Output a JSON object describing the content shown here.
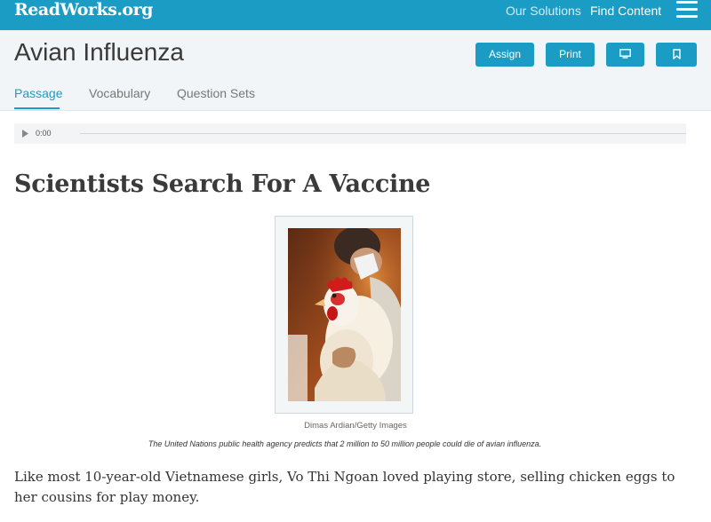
{
  "topbar": {
    "logo_main": "ReadWorks",
    "logo_tld": ".org",
    "nav_solutions": "Our Solutions",
    "nav_find": "Find Content",
    "menu_icon": "hamburger-menu-icon",
    "color": "#1a9cc4"
  },
  "header": {
    "title": "Avian Influenza",
    "buttons": {
      "assign": "Assign",
      "print": "Print",
      "present_icon": "monitor-icon",
      "bookmark_icon": "bookmark-icon"
    },
    "tabs": [
      {
        "label": "Passage",
        "active": true
      },
      {
        "label": "Vocabulary",
        "active": false
      },
      {
        "label": "Question Sets",
        "active": false
      }
    ]
  },
  "audio": {
    "play_icon": "play-icon",
    "time": "0:00",
    "progress": 0
  },
  "article": {
    "title": "Scientists Search For A Vaccine",
    "image_credit": "Dimas Ardian/Getty Images",
    "caption": "The United Nations public health agency predicts that 2 million to 50 million people could die of avian influenza.",
    "body": "Like most 10-year-old Vietnamese girls, Vo Thi Ngoan loved playing store, selling chicken eggs to her cousins for play money."
  }
}
